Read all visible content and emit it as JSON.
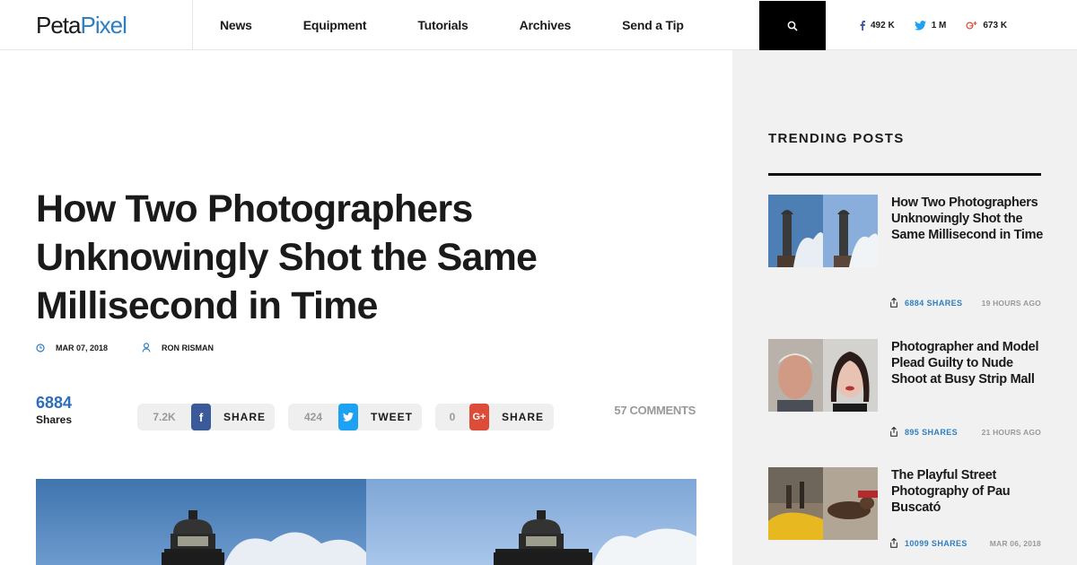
{
  "header": {
    "logo_peta": "Peta",
    "logo_pixel": "Pixel",
    "nav": [
      "News",
      "Equipment",
      "Tutorials",
      "Archives",
      "Send a Tip"
    ],
    "social": {
      "facebook": "492 K",
      "twitter": "1 M",
      "googleplus": "673 K"
    }
  },
  "article": {
    "title": "How Two Photographers Unknowingly Shot the Same Millisecond in Time",
    "date": "MAR 07, 2018",
    "author": "RON RISMAN",
    "share_total": "6884",
    "share_total_label": "Shares",
    "buttons": {
      "facebook": {
        "count": "7.2K",
        "icon": "f",
        "label": "SHARE"
      },
      "twitter": {
        "count": "424",
        "label": "TWEET"
      },
      "googleplus": {
        "count": "0",
        "icon": "G+",
        "label": "SHARE"
      }
    },
    "comments": "57 COMMENTS"
  },
  "sidebar": {
    "title": "TRENDING POSTS",
    "posts": [
      {
        "title": "How Two Photographers Unknowingly Shot the Same Millisecond in Time",
        "shares": "6884 SHARES",
        "ago": "19 HOURS AGO"
      },
      {
        "title": "Photographer and Model Plead Guilty to Nude Shoot at Busy Strip Mall",
        "shares": "895 SHARES",
        "ago": "21 HOURS AGO"
      },
      {
        "title": "The Playful Street Photography of Pau Buscató",
        "shares": "10099 SHARES",
        "ago": "MAR 06, 2018"
      }
    ]
  },
  "colors": {
    "accent_blue": "#2d7fc1",
    "facebook": "#3b5a9a",
    "twitter": "#1da1f2",
    "googleplus": "#dd4b39"
  }
}
